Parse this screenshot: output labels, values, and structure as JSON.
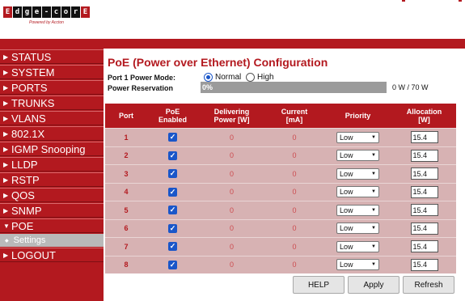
{
  "brand": {
    "logo_letters": [
      "E",
      "d",
      "g",
      "e",
      "-",
      "c",
      "o",
      "r",
      "E"
    ],
    "tagline": "Powered by Accton",
    "accent_color": "#b3191f"
  },
  "sidebar": {
    "items": [
      {
        "label": "STATUS",
        "icon": "triangle-right-icon"
      },
      {
        "label": "SYSTEM",
        "icon": "triangle-right-icon"
      },
      {
        "label": "PORTS",
        "icon": "triangle-right-icon"
      },
      {
        "label": "TRUNKS",
        "icon": "triangle-right-icon"
      },
      {
        "label": "VLANS",
        "icon": "triangle-right-icon"
      },
      {
        "label": "802.1X",
        "icon": "triangle-right-icon"
      },
      {
        "label": "IGMP Snooping",
        "icon": "triangle-right-icon"
      },
      {
        "label": "LLDP",
        "icon": "triangle-right-icon"
      },
      {
        "label": "RSTP",
        "icon": "triangle-right-icon"
      },
      {
        "label": "QOS",
        "icon": "triangle-right-icon"
      },
      {
        "label": "SNMP",
        "icon": "triangle-right-icon"
      },
      {
        "label": "POE",
        "icon": "triangle-down-icon",
        "expanded": true
      }
    ],
    "subitems": [
      {
        "label": "Settings",
        "selected": true
      }
    ],
    "logout": {
      "label": "LOGOUT",
      "icon": "triangle-right-icon"
    }
  },
  "page": {
    "title": "PoE (Power over Ethernet) Configuration",
    "power_mode_label": "Port 1 Power Mode:",
    "power_mode_options": [
      {
        "label": "Normal",
        "selected": true
      },
      {
        "label": "High",
        "selected": false
      }
    ],
    "reservation_label": "Power Reservation",
    "reservation_bar_text": "0%",
    "reservation_percent": 0,
    "reservation_value": "0 W / 70 W"
  },
  "table": {
    "headers": {
      "port": "Port",
      "enabled": [
        "PoE",
        "Enabled"
      ],
      "delivering": [
        "Delivering",
        "Power [W]"
      ],
      "current": [
        "Current",
        "[mA]"
      ],
      "priority": "Priority",
      "allocation": [
        "Allocation",
        "[W]"
      ]
    },
    "rows": [
      {
        "port": "1",
        "enabled": true,
        "delivering": "0",
        "current": "0",
        "priority": "Low",
        "allocation": "15.4"
      },
      {
        "port": "2",
        "enabled": true,
        "delivering": "0",
        "current": "0",
        "priority": "Low",
        "allocation": "15.4"
      },
      {
        "port": "3",
        "enabled": true,
        "delivering": "0",
        "current": "0",
        "priority": "Low",
        "allocation": "15.4"
      },
      {
        "port": "4",
        "enabled": true,
        "delivering": "0",
        "current": "0",
        "priority": "Low",
        "allocation": "15.4"
      },
      {
        "port": "5",
        "enabled": true,
        "delivering": "0",
        "current": "0",
        "priority": "Low",
        "allocation": "15.4"
      },
      {
        "port": "6",
        "enabled": true,
        "delivering": "0",
        "current": "0",
        "priority": "Low",
        "allocation": "15.4"
      },
      {
        "port": "7",
        "enabled": true,
        "delivering": "0",
        "current": "0",
        "priority": "Low",
        "allocation": "15.4"
      },
      {
        "port": "8",
        "enabled": true,
        "delivering": "0",
        "current": "0",
        "priority": "Low",
        "allocation": "15.4"
      }
    ]
  },
  "buttons": {
    "help": "HELP",
    "apply": "Apply",
    "refresh": "Refresh"
  }
}
